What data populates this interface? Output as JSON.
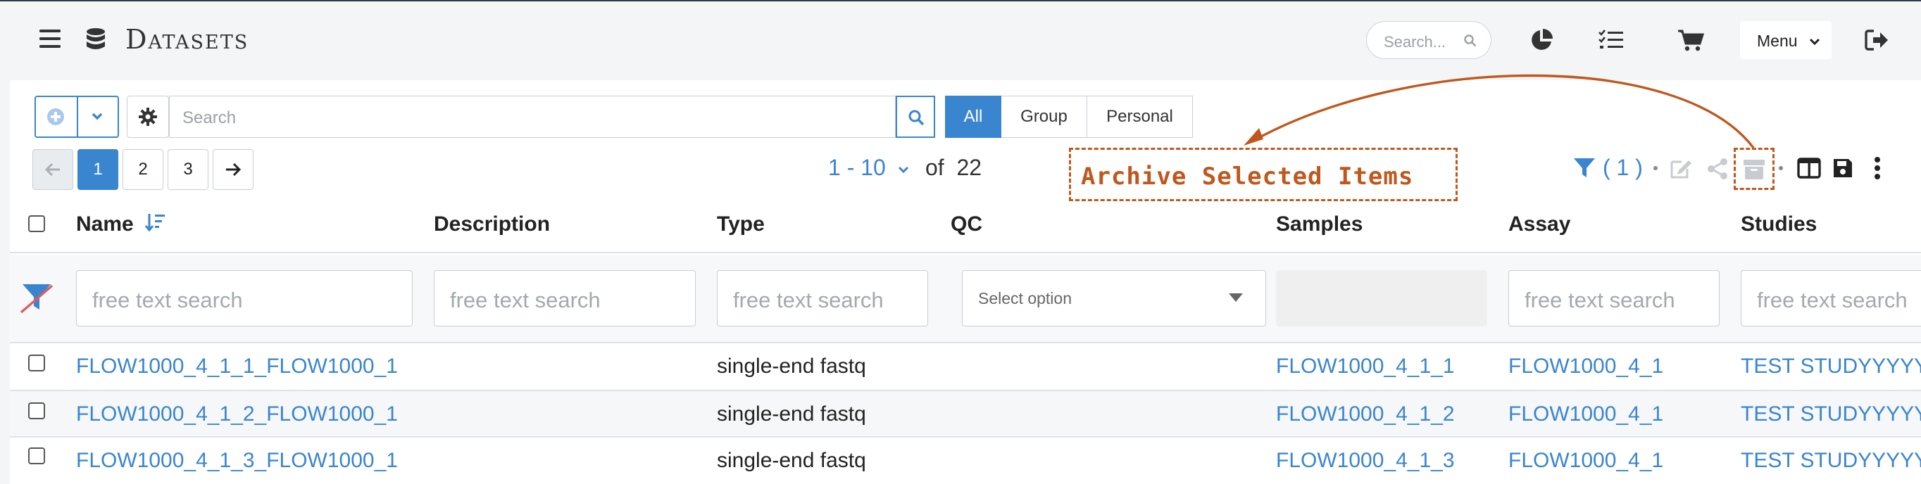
{
  "header": {
    "title": "Datasets",
    "search_placeholder": "Search...",
    "menu_label": "Menu"
  },
  "toolbar": {
    "search_placeholder": "Search",
    "scope_tabs": [
      "All",
      "Group",
      "Personal"
    ],
    "active_scope": "All"
  },
  "pagination": {
    "pages": [
      "1",
      "2",
      "3"
    ],
    "current_page": "1",
    "range_label": "1 - 10",
    "of_label": "of",
    "total": "22"
  },
  "actions": {
    "filter_count": "( 1 )"
  },
  "annotation": {
    "label": "Archive Selected Items",
    "color": "#c0581d"
  },
  "table": {
    "columns": {
      "name": "Name",
      "description": "Description",
      "type": "Type",
      "qc": "QC",
      "samples": "Samples",
      "assay": "Assay",
      "studies": "Studies"
    },
    "filters": {
      "text_placeholder": "free text search",
      "select_placeholder": "Select option"
    },
    "rows": [
      {
        "name": "FLOW1000_4_1_1_FLOW1000_1",
        "type": "single-end fastq",
        "samples": "FLOW1000_4_1_1",
        "assay": "FLOW1000_4_1",
        "studies": "TEST STUDYYYYY"
      },
      {
        "name": "FLOW1000_4_1_2_FLOW1000_1",
        "type": "single-end fastq",
        "samples": "FLOW1000_4_1_2",
        "assay": "FLOW1000_4_1",
        "studies": "TEST STUDYYYYY"
      },
      {
        "name": "FLOW1000_4_1_3_FLOW1000_1",
        "type": "single-end fastq",
        "samples": "FLOW1000_4_1_3",
        "assay": "FLOW1000_4_1",
        "studies": "TEST STUDYYYYY"
      }
    ]
  },
  "colors": {
    "accent": "#3a85d0",
    "header_icon": "#333333"
  }
}
